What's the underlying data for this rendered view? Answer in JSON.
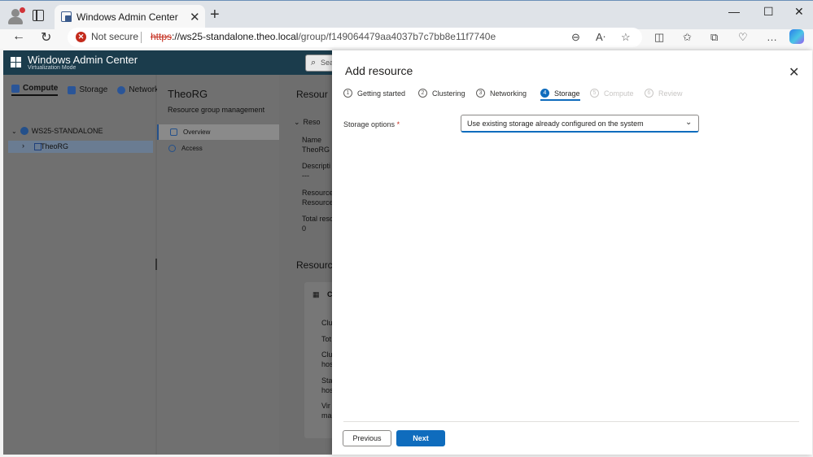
{
  "browser": {
    "tab_title": "Windows Admin Center",
    "security_label": "Not secure",
    "url_scheme": "https",
    "url_host": "://ws25-standalone.theo.local",
    "url_path": "/group/f149064479aa4037b7c7bb8e11f7740e"
  },
  "wac": {
    "title": "Windows Admin Center",
    "subtitle": "Virtualization Mode",
    "search_placeholder": "Sea"
  },
  "left_nav": {
    "tabs": [
      {
        "label": "Compute",
        "icon": "compute-icon"
      },
      {
        "label": "Storage",
        "icon": "storage-icon"
      },
      {
        "label": "Network",
        "icon": "network-icon"
      }
    ],
    "tree": {
      "root": "WS25-STANDALONE",
      "child": "TheoRG"
    }
  },
  "mid_pane": {
    "title": "TheoRG",
    "subtitle": "Resource group management",
    "items": [
      {
        "label": "Overview",
        "icon": "overview-icon"
      },
      {
        "label": "Access",
        "icon": "people-icon"
      }
    ]
  },
  "content": {
    "heading1": "Resour",
    "section": "Reso",
    "name_label": "Name",
    "name_value": "TheoRG",
    "desc_label": "Descripti",
    "desc_value": "---",
    "res_label1": "Resource",
    "res_label2": "Resource",
    "total_label": "Total reso",
    "total_value": "0",
    "heading2": "Resource",
    "card_title": "C",
    "card_lines": [
      "Clu",
      "Tot",
      "Clu",
      "hos",
      "Sta",
      "hos",
      "Vir",
      "ma"
    ]
  },
  "panel": {
    "title": "Add resource",
    "steps": [
      {
        "num": "1",
        "label": "Getting started",
        "state": "done"
      },
      {
        "num": "2",
        "label": "Clustering",
        "state": "done"
      },
      {
        "num": "3",
        "label": "Networking",
        "state": "done"
      },
      {
        "num": "4",
        "label": "Storage",
        "state": "active"
      },
      {
        "num": "5",
        "label": "Compute",
        "state": "disabled"
      },
      {
        "num": "6",
        "label": "Review",
        "state": "disabled"
      }
    ],
    "storage_label": "Storage options",
    "required_mark": "*",
    "storage_value": "Use existing storage already configured on the system",
    "previous_label": "Previous",
    "next_label": "Next"
  },
  "colors": {
    "accent": "#0f6cbd",
    "wac_header": "#1b3c4c",
    "insecure": "#c42b1c"
  }
}
